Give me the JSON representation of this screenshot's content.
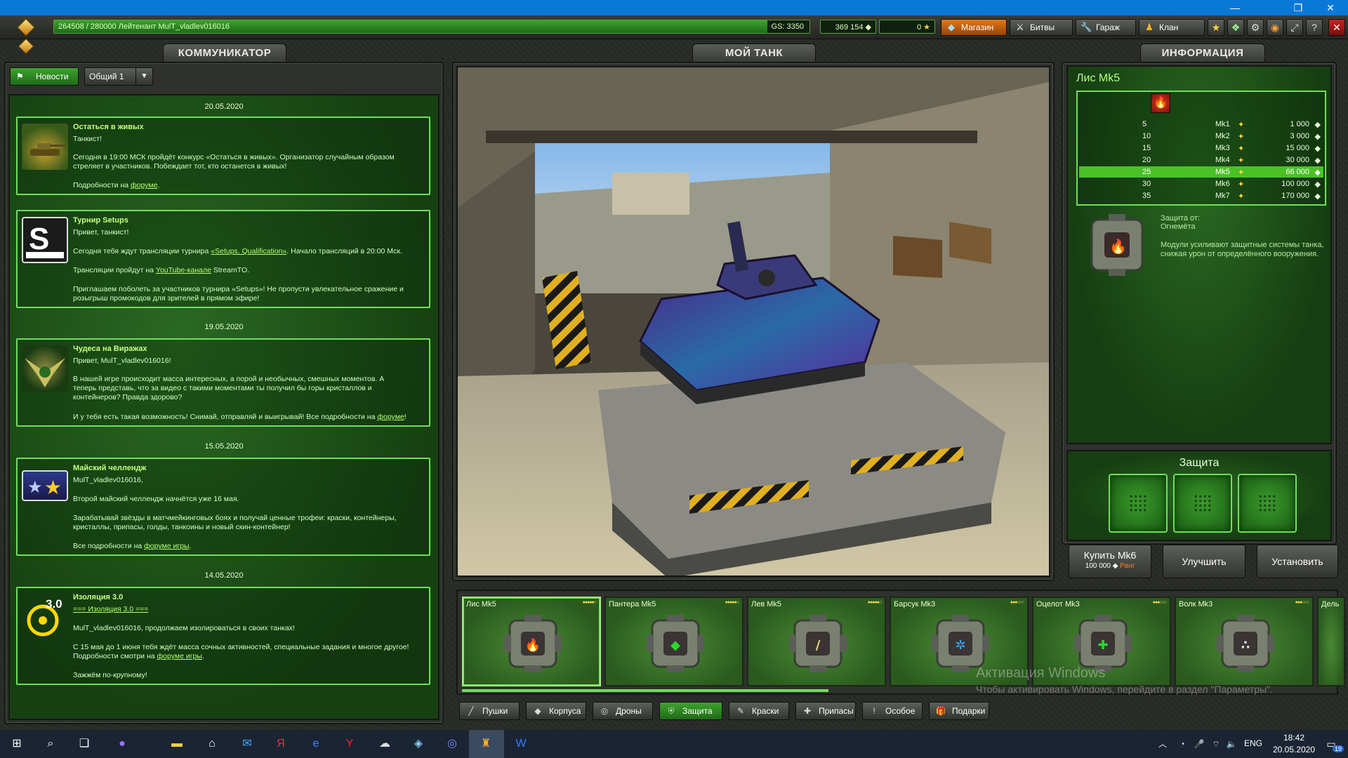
{
  "topbar": {
    "xp_text": "264508 / 280000   Лейтенант MulT_vladlev016016",
    "xp_progress": 0.9447,
    "gs_text": "GS: 3350",
    "crystals": "369 154",
    "stars": "0",
    "nav": [
      "Магазин",
      "Битвы",
      "Гараж",
      "Клан"
    ]
  },
  "communicator": {
    "tab": "КОММУНИКАТОР",
    "filter_news": "Новости",
    "filter_channel": "Общий 1",
    "news": [
      {
        "date": "20.05.2020",
        "title": "Остаться в живых",
        "lines": [
          "Танкист!",
          "Сегодня в 19:00 МСК пройдёт конкурс «Остаться в живых». Организатор случайным образом",
          "стреляет в участников. Побеждает тот, кто останется в живых!"
        ],
        "link_prefix": "Подробности на ",
        "link": "форуме",
        "link_suffix": "."
      },
      {
        "title": "Турнир  Setups",
        "greet": "Привет, танкист!",
        "l1_prefix": "Сегодня тебя ждут трансляции турнира ",
        "l1_link": "«Setups. Qualification»",
        "l1_suffix": ".  Начало трансляций в 20:00 Мск.",
        "l2_prefix": "Трансляции пройдут на ",
        "l2_link": "YouTube-канале",
        "l2_suffix": "  StreamTO.",
        "l3": "Приглашаем поболеть за участников турнира «Setups»! Не пропусти увлекательное сражение и",
        "l4": "розыгрыш промокодов для зрителей в прямом эфире!"
      },
      {
        "date": "19.05.2020",
        "title": "Чудеса на Виражах",
        "greet": "Привет, MulT_vladlev016016!",
        "lines": [
          "В нашей игре происходит масса интересных, а порой и необычных, смешных моментов. А",
          "теперь представь, что за видео с такими моментами ты получил бы горы кристаллов и",
          "контейнеров? Правда здорово?"
        ],
        "last_prefix": " И у тебя есть такая возможность! Снимай, отправляй и выигрывай! Все подробности на ",
        "last_link": "форуме",
        "last_suffix": "!"
      },
      {
        "date": "15.05.2020",
        "title": "Майский челлендж",
        "greet": "MulT_vladlev016016,",
        "lines": [
          "Второй майский челлендж начнётся уже 16 мая.",
          "Зарабатывай звёзды в матчмейкинговых боях и получай ценные трофеи: краски, контейнеры,",
          "кристаллы, припасы, голды, танкоины и новый скин-контейнер!"
        ],
        "link_prefix": "Все подробности на ",
        "link": "форуме игры",
        "link_suffix": "."
      },
      {
        "date": "14.05.2020",
        "title": "Изоляция 3.0",
        "sub_link": "=== Изоляция 3.0 ===",
        "greet": "MulT_vladlev016016, продолжаем изолироваться в своих танках!",
        "lines": [
          "С 15 мая до 1 июня тебя ждёт масса сочных активностей, специальные задания и многое другое!"
        ],
        "link_prefix": "Подробности смотри на ",
        "link": "форуме игры",
        "link_suffix": ".",
        "bye": "Зажжём по-крупному!",
        "badge": "3.0"
      }
    ]
  },
  "garage": {
    "tab": "МОЙ ТАНК"
  },
  "info": {
    "tab": "ИНФОРМАЦИЯ",
    "title": "Лис Mk5",
    "upgrades": [
      {
        "rank": "5",
        "mk": "Mk1",
        "price": "1 000"
      },
      {
        "rank": "10",
        "mk": "Mk2",
        "price": "3 000"
      },
      {
        "rank": "15",
        "mk": "Mk3",
        "price": "15 000"
      },
      {
        "rank": "20",
        "mk": "Mk4",
        "price": "30 000"
      },
      {
        "rank": "25",
        "mk": "Mk5",
        "price": "66 000"
      },
      {
        "rank": "30",
        "mk": "Mk6",
        "price": "100 000"
      },
      {
        "rank": "35",
        "mk": "Mk7",
        "price": "170 000"
      }
    ],
    "selected_index": 4,
    "protect_label": "Защита от:",
    "protect_value": "Огнемёта",
    "desc_1": "Модули усиливают защитные системы танка,",
    "desc_2": "снижая урон от определённого вооружения."
  },
  "protection": {
    "title": "Защита"
  },
  "actions": {
    "buy": "Купить Mk6",
    "buy_price": "100 000",
    "buy_rank": "Ранг",
    "upgrade": "Улучшить",
    "install": "Установить"
  },
  "modules": [
    {
      "name": "Лис Mk5",
      "stars": "●●●●●○",
      "color": "#e03a20",
      "glyph": "🔥"
    },
    {
      "name": "Пантера Mk5",
      "stars": "●●●●●○",
      "color": "#2ad82a",
      "glyph": "◆"
    },
    {
      "name": "Лев Mk5",
      "stars": "●●●●●○",
      "color": "#f0e080",
      "glyph": "/"
    },
    {
      "name": "Барсук Mk3",
      "stars": "●●●○○○",
      "color": "#38a8ff",
      "glyph": "✲"
    },
    {
      "name": "Оцелот Mk3",
      "stars": "●●●○○○",
      "color": "#2ad82a",
      "glyph": "✚"
    },
    {
      "name": "Волк Mk3",
      "stars": "●●●○○○",
      "color": "#dddddd",
      "glyph": "∴"
    },
    {
      "name": "Дель"
    }
  ],
  "categories": [
    "Пушки",
    "Корпуса",
    "Дроны",
    "Защита",
    "Краски",
    "Припасы",
    "Особое",
    "Подарки"
  ],
  "selected_category": 3,
  "watermark": {
    "title": "Активация Windows",
    "text": "Чтобы активировать Windows, перейдите в раздел \"Параметры\"."
  },
  "taskbar": {
    "lang": "ENG",
    "time": "18:42",
    "date": "20.05.2020",
    "notif": "19"
  }
}
